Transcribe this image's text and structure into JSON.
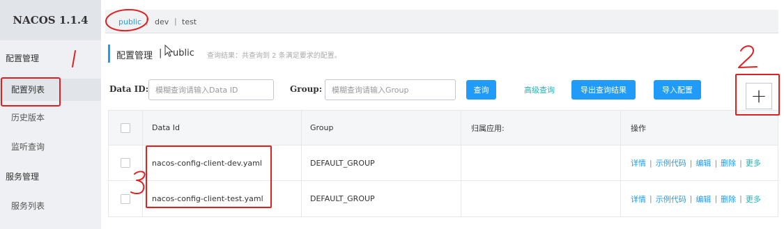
{
  "sidebar": {
    "brand": "NACOS 1.1.4",
    "groups": [
      {
        "label": "配置管理"
      },
      {
        "label": "服务管理"
      }
    ],
    "items": [
      {
        "label": "配置列表"
      },
      {
        "label": "历史版本"
      },
      {
        "label": "监听查询"
      },
      {
        "label": "服务列表"
      }
    ]
  },
  "namespaces": [
    "public",
    "dev",
    "test"
  ],
  "namespace_separator": "|",
  "header": {
    "title": "配置管理",
    "separator": "|",
    "namespace": "ublic",
    "result_text": "查询结果：共查询到 2 条满足要求的配置。"
  },
  "search": {
    "data_id_label": "Data ID:",
    "data_id_placeholder": "模糊查询请输入Data ID",
    "group_label": "Group:",
    "group_placeholder": "模糊查询请输入Group",
    "query_button": "查询",
    "advanced_query": "高级查询",
    "export_button": "导出查询结果",
    "import_button": "导入配置",
    "add_button": "+"
  },
  "table": {
    "columns": [
      "Data Id",
      "Group",
      "归属应用:",
      "操作"
    ],
    "rows": [
      {
        "data_id": "nacos-config-client-dev.yaml",
        "group": "DEFAULT_GROUP",
        "app": ""
      },
      {
        "data_id": "nacos-config-client-test.yaml",
        "group": "DEFAULT_GROUP",
        "app": ""
      }
    ],
    "operations": [
      "详情",
      "示例代码",
      "编辑",
      "删除",
      "更多"
    ],
    "operation_separator": "|"
  },
  "annotations": {
    "color": "#e02020",
    "marks": [
      "1",
      "2",
      "3"
    ]
  },
  "colors": {
    "accent": "#209bfa",
    "link_teal": "#1eb4b4",
    "sidebar_bg": "#eef0f3"
  }
}
